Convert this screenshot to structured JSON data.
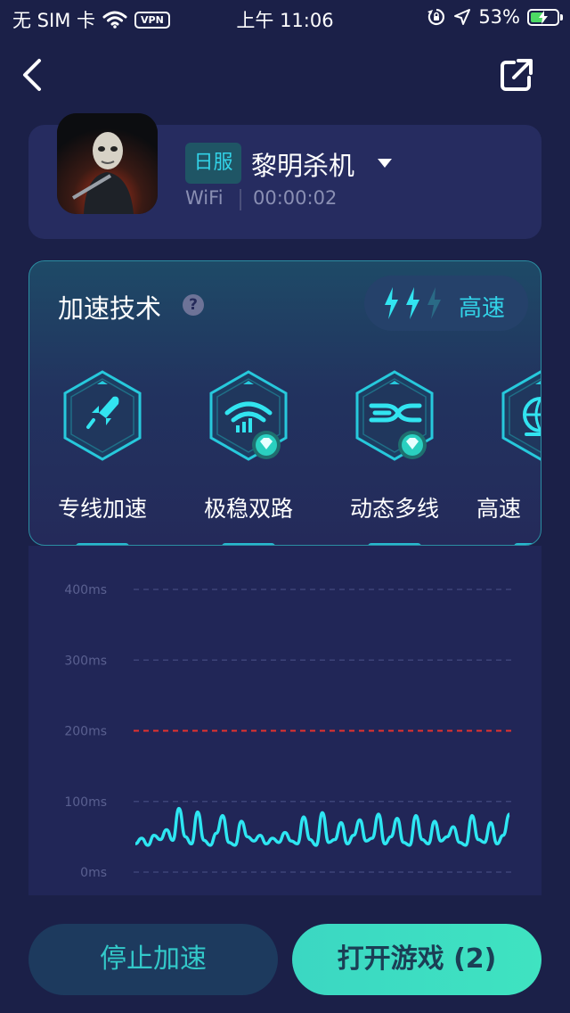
{
  "status_bar": {
    "carrier": "无 SIM 卡",
    "vpn": "VPN",
    "time": "上午 11:06",
    "battery": "53%",
    "battery_level": 0.53
  },
  "game": {
    "region": "日服",
    "name": "黎明杀机",
    "network": "WiFi",
    "elapsed": "00:00:02"
  },
  "tech": {
    "title": "加速技术",
    "help": "?",
    "speed_level": 2,
    "speed_max": 3,
    "speed_label": "高速",
    "features": [
      {
        "label": "专线加速",
        "icon": "rocket-icon",
        "premium": false
      },
      {
        "label": "极稳双路",
        "icon": "wifi-signal-icon",
        "premium": true
      },
      {
        "label": "动态多线",
        "icon": "multi-line-icon",
        "premium": true
      },
      {
        "label": "高速",
        "icon": "globe-icon",
        "premium": false
      }
    ]
  },
  "chart_data": {
    "type": "line",
    "y_ticks": [
      "400ms",
      "300ms",
      "200ms",
      "100ms",
      "0ms"
    ],
    "ylim": [
      0,
      400
    ],
    "threshold": 200,
    "threshold_color": "#e5322e",
    "line_color": "#2ee6f2",
    "grid": true,
    "values": [
      40,
      48,
      38,
      52,
      46,
      60,
      45,
      90,
      50,
      40,
      85,
      45,
      38,
      55,
      80,
      42,
      38,
      72,
      50,
      44,
      52,
      40,
      48,
      42,
      56,
      44,
      40,
      78,
      46,
      38,
      84,
      42,
      46,
      70,
      40,
      52,
      74,
      44,
      48,
      82,
      40,
      50,
      76,
      42,
      38,
      80,
      46,
      40,
      72,
      44,
      50,
      64,
      42,
      38,
      80,
      46,
      42,
      70,
      40,
      52,
      82
    ]
  },
  "buttons": {
    "stop": "停止加速",
    "open": "打开游戏 (2)"
  },
  "colors": {
    "background": "#1b2048",
    "accent": "#32d3e8",
    "primary_button": "#3fe3c1"
  }
}
